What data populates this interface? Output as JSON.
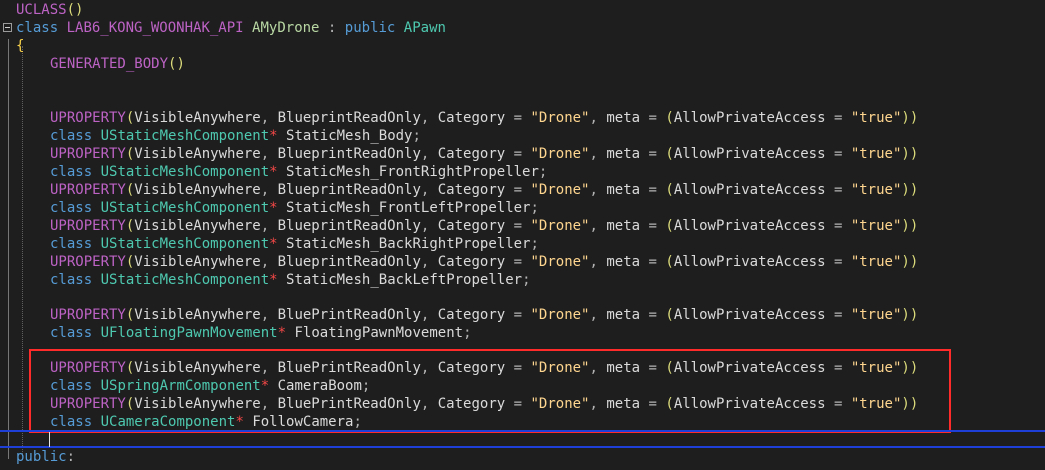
{
  "editor": {
    "l01": {
      "macro": "UCLASS",
      "parens": "()"
    },
    "l02": {
      "kw": "class",
      "api": "LAB6_KONG_WOONHAK_API",
      "cls": "AMyDrone",
      "sep": " : ",
      "kw2": "public",
      "base": "APawn"
    },
    "l03": {
      "brace": "{"
    },
    "l04": {
      "macro": "GENERATED_BODY",
      "parens": "()"
    },
    "uprop": {
      "macro": "UPROPERTY",
      "spec1": "VisibleAnywhere",
      "spec2": "BlueprintReadOnly",
      "spec2_alt": "BluePrintReadOnly",
      "category_key": "Category",
      "category_val": "\"Drone\"",
      "meta_key": "meta",
      "meta_inner_key": "AllowPrivateAccess",
      "meta_inner_val": "\"true\"",
      "eq": " = ",
      "comma": ", "
    },
    "decls": [
      {
        "type": "UStaticMeshComponent",
        "name": "StaticMesh_Body"
      },
      {
        "type": "UStaticMeshComponent",
        "name": "StaticMesh_FrontRightPropeller"
      },
      {
        "type": "UStaticMeshComponent",
        "name": "StaticMesh_FrontLeftPropeller"
      },
      {
        "type": "UStaticMeshComponent",
        "name": "StaticMesh_BackRightPropeller"
      },
      {
        "type": "UStaticMeshComponent",
        "name": "StaticMesh_BackLeftPropeller"
      },
      {
        "type": "UFloatingPawnMovement",
        "name": "FloatingPawnMovement"
      },
      {
        "type": "USpringArmComponent",
        "name": "CameraBoom"
      },
      {
        "type": "UCameraComponent",
        "name": "FollowCamera"
      }
    ],
    "class_kw": "class",
    "star": "*",
    "semicolon": ";",
    "last": {
      "kw": "public",
      "colon": ":"
    }
  }
}
